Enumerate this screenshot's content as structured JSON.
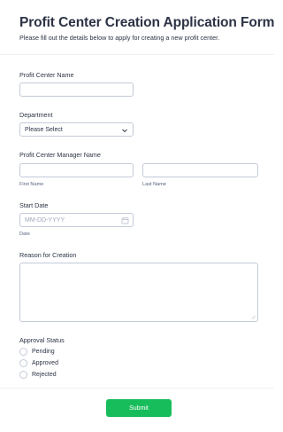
{
  "form": {
    "title": "Profit Center Creation Application Form",
    "subtitle": "Please fill out the details below to apply for creating a new profit center."
  },
  "fields": {
    "profit_center_name": {
      "label": "Profit Center Name",
      "value": ""
    },
    "department": {
      "label": "Department",
      "selected": "Please Select"
    },
    "manager_name": {
      "label": "Profit Center Manager Name",
      "first_sublabel": "First Name",
      "last_sublabel": "Last Name",
      "first_value": "",
      "last_value": ""
    },
    "start_date": {
      "label": "Start Date",
      "placeholder": "MM-DD-YYYY",
      "sublabel": "Date"
    },
    "reason": {
      "label": "Reason for Creation",
      "value": ""
    },
    "approval_status": {
      "label": "Approval Status",
      "options": [
        "Pending",
        "Approved",
        "Rejected"
      ]
    }
  },
  "submit_label": "Submit",
  "colors": {
    "submit": "#18bd5b",
    "border": "#c3cad8",
    "text": "#2c3345"
  },
  "icons": {
    "select": "chevron-down-icon",
    "date": "calendar-icon",
    "textarea": "resize-handle-icon"
  }
}
